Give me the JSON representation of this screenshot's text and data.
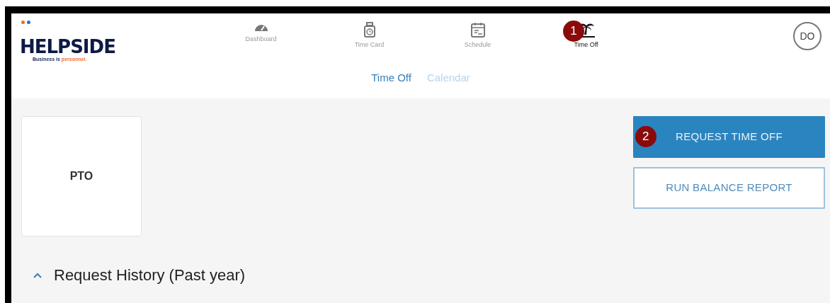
{
  "logo": {
    "name": "HELPSIDE",
    "tagline": "Business is",
    "tagline_accent": "personnel."
  },
  "nav": [
    {
      "label": "Dashboard",
      "selected": false
    },
    {
      "label": "Time Card",
      "selected": false
    },
    {
      "label": "Schedule",
      "selected": false
    },
    {
      "label": "Time Off",
      "selected": true,
      "callout": "1"
    }
  ],
  "avatar": "DO",
  "subtabs": [
    {
      "label": "Time Off",
      "selected": true
    },
    {
      "label": "Calendar",
      "selected": false
    }
  ],
  "balance_cards": [
    {
      "label": "PTO"
    }
  ],
  "actions": [
    {
      "label": "REQUEST TIME OFF",
      "kind": "primary",
      "callout": "2"
    },
    {
      "label": "RUN BALANCE REPORT",
      "kind": "outline"
    }
  ],
  "section": {
    "title": "Request History (Past year)",
    "expanded": true
  }
}
